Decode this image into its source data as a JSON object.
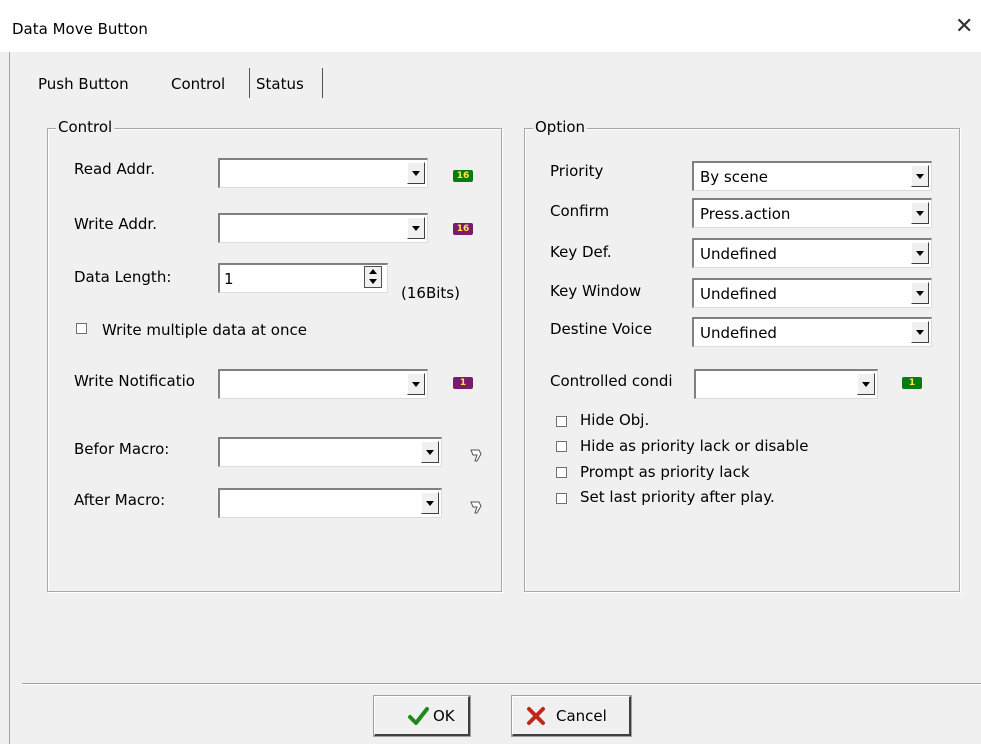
{
  "window": {
    "title": "Data Move Button",
    "close_glyph": "✕"
  },
  "tabs": [
    "Push Button",
    "Control",
    "Status"
  ],
  "active_tab": "Control",
  "control_group": {
    "title": "Control",
    "read_addr": {
      "label": "Read Addr.",
      "value": "",
      "badge": "16"
    },
    "write_addr": {
      "label": "Write Addr.",
      "value": "",
      "badge": "16"
    },
    "data_length": {
      "label": "Data Length:",
      "value": "1",
      "unit": "(16Bits)"
    },
    "write_multiple": {
      "label": "Write multiple data at once",
      "checked": false
    },
    "write_notification": {
      "label": "Write Notificatio",
      "value": "",
      "badge": "1"
    },
    "before_macro": {
      "label": "Befor Macro:",
      "value": ""
    },
    "after_macro": {
      "label": "After Macro:",
      "value": ""
    }
  },
  "option_group": {
    "title": "Option",
    "priority": {
      "label": "Priority",
      "value": "By scene"
    },
    "confirm": {
      "label": "Confirm",
      "value": "Press.action"
    },
    "key_def": {
      "label": "Key Def.",
      "value": "Undefined"
    },
    "key_window": {
      "label": "Key Window",
      "value": "Undefined"
    },
    "destine_voice": {
      "label": "Destine Voice",
      "value": "Undefined"
    },
    "controlled_condition": {
      "label": "Controlled condi",
      "value": "",
      "badge": "1"
    },
    "checkboxes": [
      {
        "label": "Hide Obj.",
        "checked": false
      },
      {
        "label": "Hide as priority lack or disable",
        "checked": false
      },
      {
        "label": "Prompt as priority lack",
        "checked": false
      },
      {
        "label": "Set last priority after play.",
        "checked": false
      }
    ]
  },
  "buttons": {
    "ok": "OK",
    "cancel": "Cancel"
  },
  "colors": {
    "badge_green": "#0a7a12",
    "badge_purple": "#7a1c6d",
    "ok_check": "#1f8a1f",
    "cancel_x": "#c0281c"
  }
}
